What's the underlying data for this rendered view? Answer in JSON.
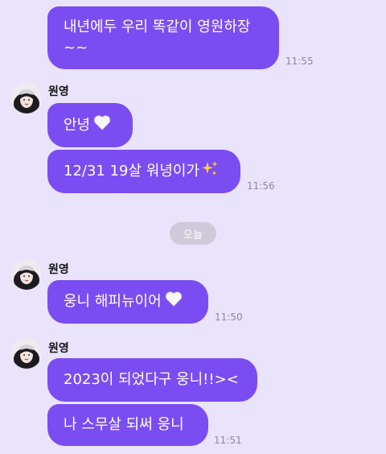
{
  "messages": [
    {
      "lines": [
        "내년에두 우리 똑같이 영원하장",
        "~~"
      ]
    },
    {
      "text": "안녕"
    },
    {
      "text": "12/31 19살 워녕이가"
    },
    {
      "text": "웅니 해피뉴이어"
    },
    {
      "text": "2023이 되었다구 웅니!!><"
    },
    {
      "text": "나 스무살 되써 웅니"
    }
  ],
  "times": [
    "11:55",
    "11:56",
    "11:50",
    "11:51"
  ],
  "sender_name": "원영",
  "date_divider": "오늘",
  "colors": {
    "background": "#e9e3fb",
    "bubble": "#7b4cf2",
    "bubble_text": "#ffffff",
    "time": "#8c8aa0",
    "date_chip": "#cfcad9"
  },
  "icons": [
    "white-heart-icon",
    "sparkles-icon",
    "profile-avatar"
  ]
}
